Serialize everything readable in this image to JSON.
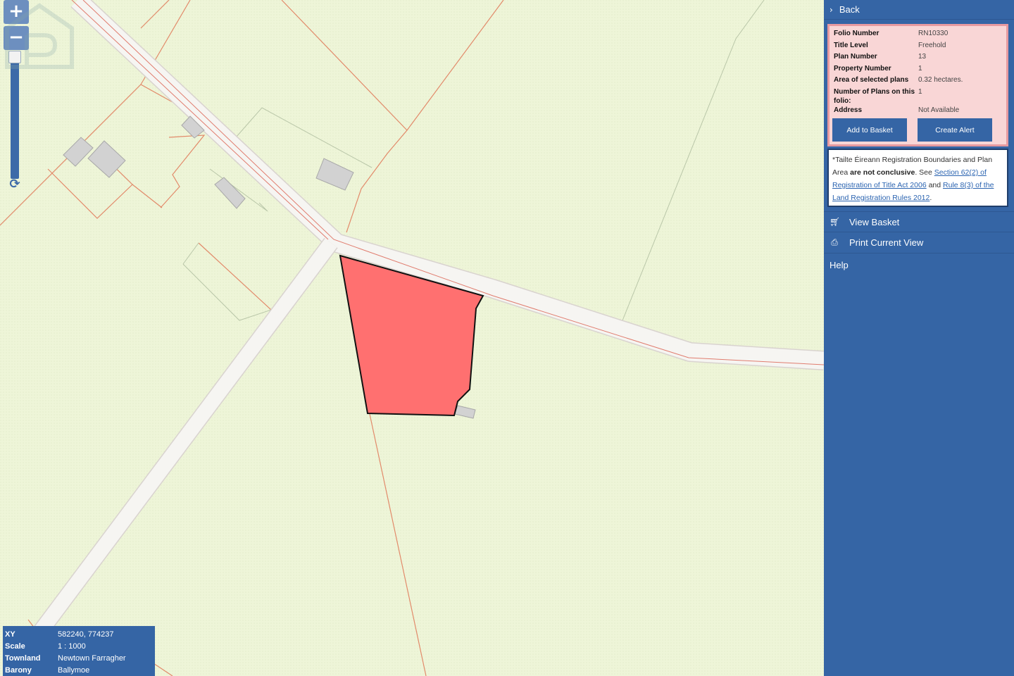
{
  "map": {
    "zoom_in_label": "+",
    "zoom_out_label": "−",
    "refresh_icon": "refresh-icon",
    "colors": {
      "background": "#eef5d8",
      "road": "#f4f5f0",
      "boundary": "#e28a6a",
      "selected_parcel": "#ff7070",
      "building": "#cccccc"
    }
  },
  "info_box": {
    "rows": [
      {
        "key": "XY",
        "value": "582240, 774237"
      },
      {
        "key": "Scale",
        "value": "1 : 1000"
      },
      {
        "key": "Townland",
        "value": "Newtown Farragher"
      },
      {
        "key": "Barony",
        "value": "Ballymoe"
      }
    ]
  },
  "sidebar": {
    "back_label": "Back",
    "details": [
      {
        "key": "Folio Number",
        "value": "RN10330"
      },
      {
        "key": "Title Level",
        "value": "Freehold"
      },
      {
        "key": "Plan Number",
        "value": "13"
      },
      {
        "key": "Property Number",
        "value": "1"
      },
      {
        "key": "Area of selected plans",
        "value": "0.32 hectares."
      },
      {
        "key": "Number of Plans on this folio:",
        "value": "1"
      },
      {
        "key": "Address",
        "value": "Not Available"
      }
    ],
    "add_to_basket_label": "Add to Basket",
    "create_alert_label": "Create Alert",
    "disclaimer": {
      "prefix": "*Tailte Éireann Registration Boundaries and Plan Area ",
      "bold": "are not conclusive",
      "mid": ". See ",
      "link1": "Section 62(2) of Registration of Title Act 2006",
      "and": " and ",
      "link2": "Rule 8(3) of the Land Registration Rules 2012",
      "suffix": "."
    },
    "menu": {
      "view_basket": "View Basket",
      "print_current_view": "Print Current View",
      "help": "Help"
    }
  }
}
